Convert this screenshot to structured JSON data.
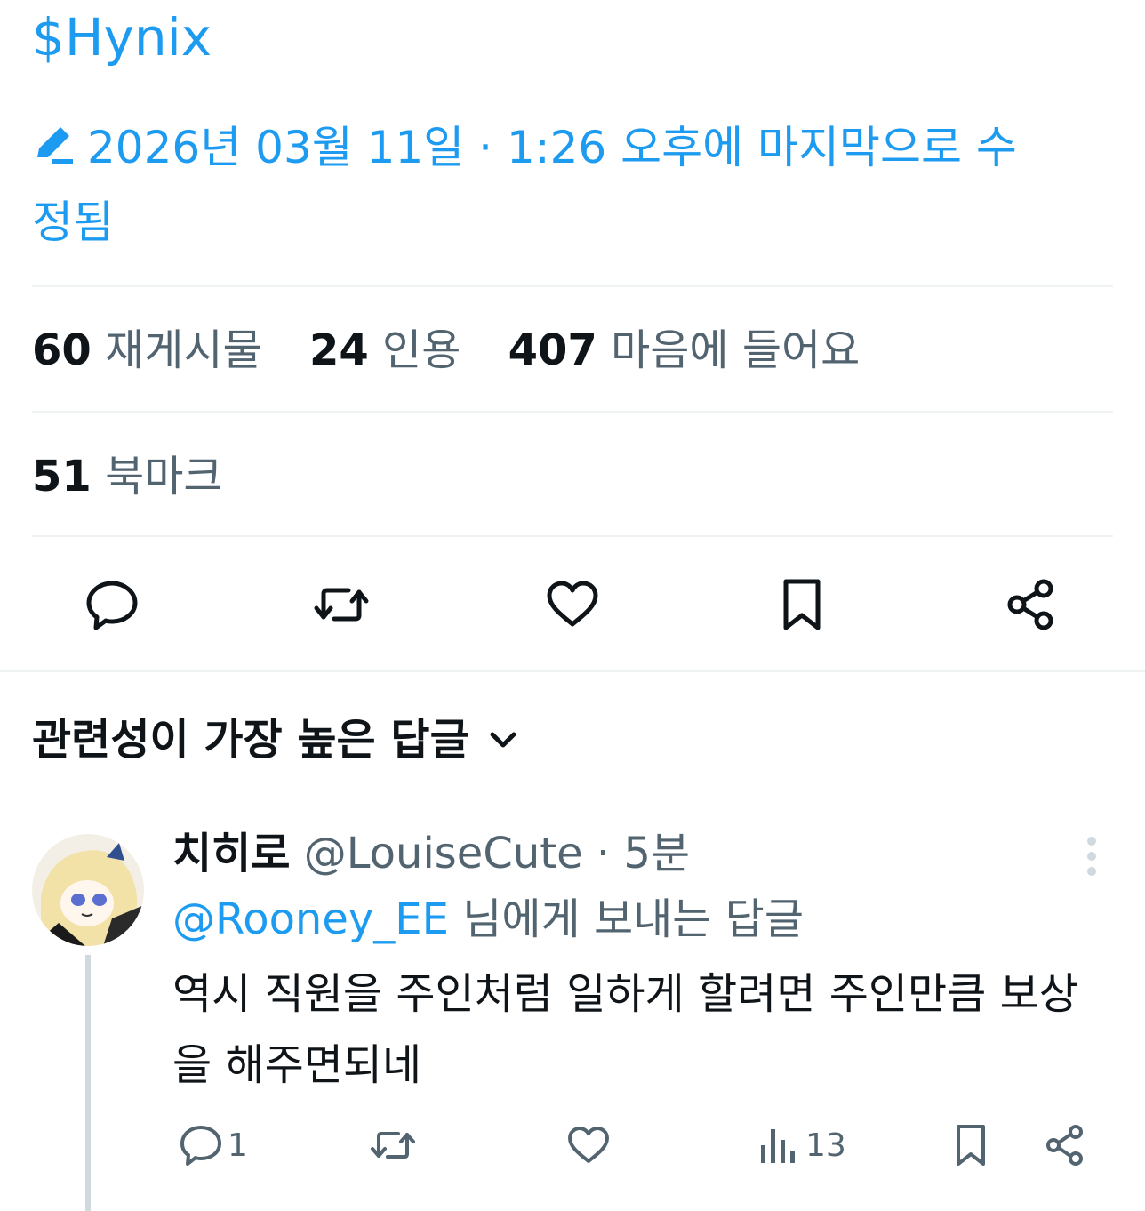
{
  "post": {
    "cashtag": "$Hynix",
    "edited_notice": "2026년 03월 11일 · 1:26 오후에 마지막으로 수정됨",
    "stats": [
      {
        "count": "60",
        "label": "재게시물"
      },
      {
        "count": "24",
        "label": "인용"
      },
      {
        "count": "407",
        "label": "마음에 들어요"
      }
    ],
    "bookmarks": {
      "count": "51",
      "label": "북마크"
    },
    "actions": [
      "reply",
      "repost",
      "like",
      "bookmark",
      "share"
    ]
  },
  "replies_section": {
    "sort_label": "관련성이 가장 높은 답글"
  },
  "reply": {
    "display_name": "치히로",
    "handle": "@LouiseCute",
    "separator": " · ",
    "time": "5분",
    "replying_to_handle": "@Rooney_EE",
    "replying_to_suffix": " 님에게 보내는 답글",
    "text": "역시 직원을 주인처럼 일하게 할려면 주인만큼 보상을 해주면되네",
    "reply_count": "1",
    "view_count": "13"
  },
  "colors": {
    "accent": "#1d9bf0",
    "text": "#0f1419",
    "muted": "#536471",
    "divider": "#eff3f4"
  }
}
